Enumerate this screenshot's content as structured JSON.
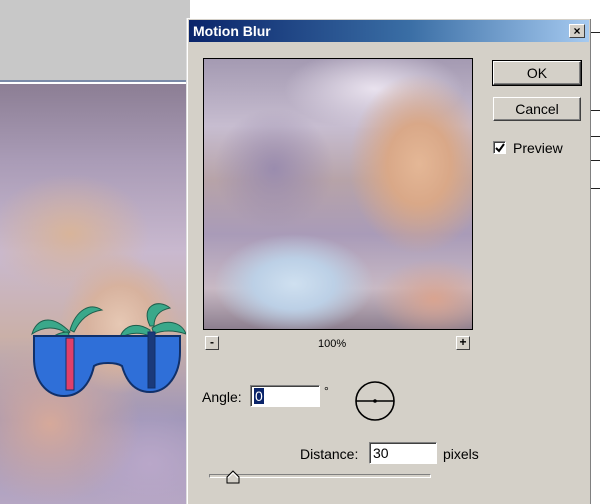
{
  "dialog": {
    "title": "Motion Blur",
    "close_glyph": "×",
    "buttons": {
      "ok": "OK",
      "cancel": "Cancel"
    },
    "preview": {
      "checkbox_label": "Preview",
      "checked": true,
      "zoom_level": "100%",
      "zoom_out": "-",
      "zoom_in": "+"
    },
    "angle": {
      "label": "Angle:",
      "value": "0",
      "unit": "°"
    },
    "distance": {
      "label": "Distance:",
      "value": "30",
      "unit": "pixels",
      "slider_fraction": 0.08
    }
  },
  "colors": {
    "titlebar_start": "#0a246a",
    "titlebar_end": "#a6caf0",
    "dialog_face": "#d4d0c8",
    "sunglasses_blue": "#2f6fd8",
    "palm_green": "#3aa88a"
  },
  "icons": [
    "close-icon",
    "checkmark-icon",
    "angle-dial-icon",
    "slider-thumb-icon",
    "palm-tree-sunglasses-icon"
  ]
}
